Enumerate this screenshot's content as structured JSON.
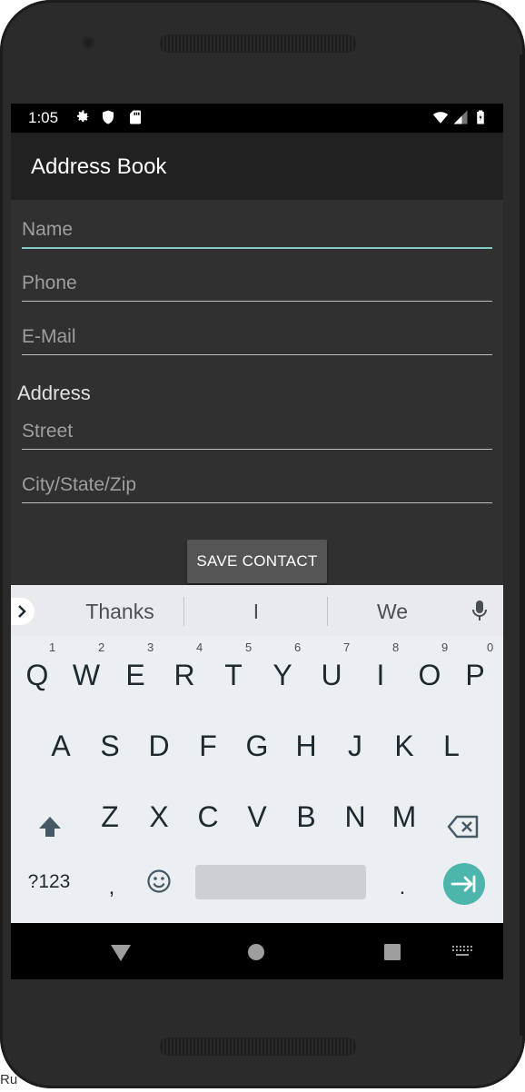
{
  "statusbar": {
    "time": "1:05"
  },
  "appbar": {
    "title": "Address Book"
  },
  "form": {
    "name_placeholder": "Name",
    "phone_placeholder": "Phone",
    "email_placeholder": "E-Mail",
    "address_label": "Address",
    "street_placeholder": "Street",
    "citystatezip_placeholder": "City/State/Zip",
    "save_label": "SAVE CONTACT"
  },
  "keyboard": {
    "suggestions": [
      "Thanks",
      "I",
      "We"
    ],
    "row1": [
      "Q",
      "W",
      "E",
      "R",
      "T",
      "Y",
      "U",
      "I",
      "O",
      "P"
    ],
    "row1_hints": [
      "1",
      "2",
      "3",
      "4",
      "5",
      "6",
      "7",
      "8",
      "9",
      "0"
    ],
    "row2": [
      "A",
      "S",
      "D",
      "F",
      "G",
      "H",
      "J",
      "K",
      "L"
    ],
    "row3": [
      "Z",
      "X",
      "C",
      "V",
      "B",
      "N",
      "M"
    ],
    "symbols_label": "?123",
    "comma": ",",
    "period": "."
  },
  "colors": {
    "accent": "#80cbc4",
    "enter": "#4db6ac"
  },
  "icons": [
    "settings-icon",
    "shield-icon",
    "sd-card-icon",
    "wifi-icon",
    "signal-icon",
    "battery-icon",
    "mic-icon",
    "shift-icon",
    "backspace-icon",
    "emoji-icon",
    "enter-icon",
    "nav-back-icon",
    "nav-home-icon",
    "nav-recents-icon",
    "keyboard-switch-icon"
  ],
  "caption_fragment": "Ru"
}
